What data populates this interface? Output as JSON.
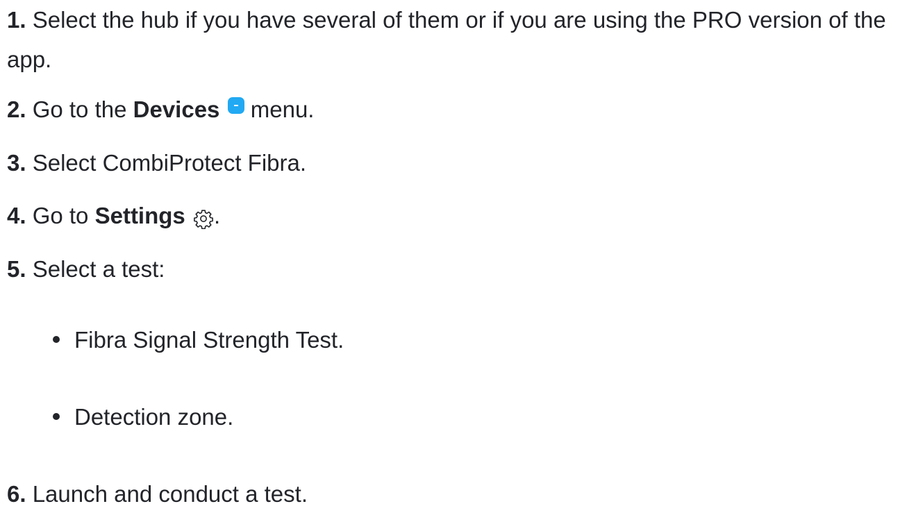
{
  "steps": [
    {
      "number": "1.",
      "text": "Select the hub if you have several of them or if you are using the PRO version of the app."
    },
    {
      "number": "2.",
      "before": "Go to the ",
      "bold": "Devices",
      "after": " menu.",
      "icon": "devices-icon"
    },
    {
      "number": "3.",
      "text": "Select CombiProtect Fibra."
    },
    {
      "number": "4.",
      "before": "Go to ",
      "bold": "Settings",
      "after": ".",
      "icon": "gear-icon"
    },
    {
      "number": "5.",
      "text": "Select a test:"
    },
    {
      "number": "6.",
      "text": "Launch and conduct a test."
    }
  ],
  "tests": [
    {
      "text": "Fibra Signal Strength Test."
    },
    {
      "text": "Detection zone."
    }
  ],
  "colors": {
    "text": "#222429",
    "devices_icon": "#21a9f3"
  }
}
